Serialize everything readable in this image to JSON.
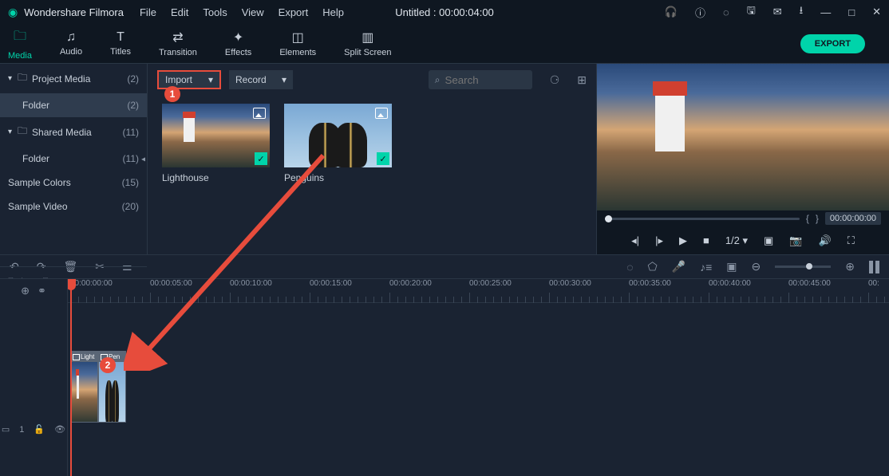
{
  "app": {
    "title": "Wondershare Filmora"
  },
  "menu": {
    "file": "File",
    "edit": "Edit",
    "tools": "Tools",
    "view": "View",
    "export": "Export",
    "help": "Help"
  },
  "doc": {
    "title": "Untitled : 00:00:04:00"
  },
  "tabs": {
    "media": "Media",
    "audio": "Audio",
    "titles": "Titles",
    "transition": "Transition",
    "effects": "Effects",
    "elements": "Elements",
    "split": "Split Screen",
    "export_btn": "EXPORT"
  },
  "sidebar": {
    "items": [
      {
        "label": "Project Media",
        "count": "(2)"
      },
      {
        "label": "Folder",
        "count": "(2)"
      },
      {
        "label": "Shared Media",
        "count": "(11)"
      },
      {
        "label": "Folder",
        "count": "(11)"
      },
      {
        "label": "Sample Colors",
        "count": "(15)"
      },
      {
        "label": "Sample Video",
        "count": "(20)"
      }
    ]
  },
  "toolbar": {
    "import": "Import",
    "record": "Record",
    "search_placeholder": "Search"
  },
  "thumbs": {
    "lighthouse": "Lighthouse",
    "penguins": "Penguins"
  },
  "preview": {
    "time": "00:00:00:00",
    "speed": "1/2",
    "brace_l": "{",
    "brace_r": "}"
  },
  "timeline": {
    "track_label": "1",
    "marks": [
      "00:00:00:00",
      "00:00:05:00",
      "00:00:10:00",
      "00:00:15:00",
      "00:00:20:00",
      "00:00:25:00",
      "00:00:30:00",
      "00:00:35:00",
      "00:00:40:00",
      "00:00:45:00",
      "00:"
    ],
    "clip1": "Light",
    "clip2": "Pen"
  },
  "markers": {
    "one": "1",
    "two": "2"
  }
}
